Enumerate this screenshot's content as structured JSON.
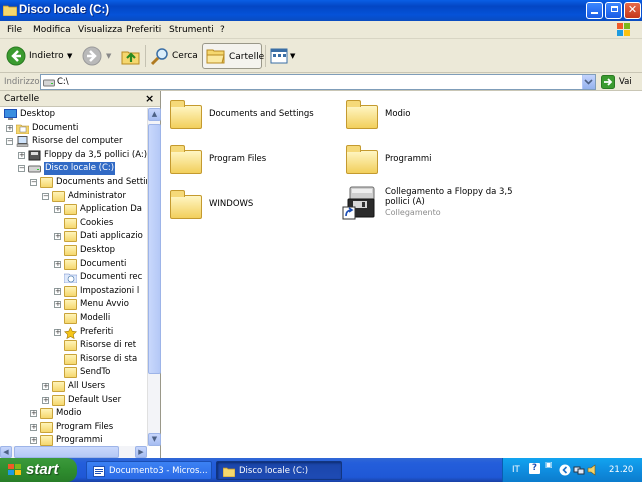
{
  "window": {
    "title": "Disco locale (C:)"
  },
  "menu": [
    "File",
    "Modifica",
    "Visualizza",
    "Preferiti",
    "Strumenti",
    "?"
  ],
  "toolbar": {
    "back": "Indietro",
    "search": "Cerca",
    "folders": "Cartelle"
  },
  "address": {
    "label": "Indirizzo",
    "value": "C:\\",
    "go": "Vai"
  },
  "folders_pane": {
    "title": "Cartelle",
    "close": "×",
    "tree": [
      {
        "label": "Desktop",
        "level": 0,
        "expander": "",
        "icon": "desktop-icon"
      },
      {
        "label": "Documenti",
        "level": 1,
        "expander": "+",
        "icon": "documents-icon"
      },
      {
        "label": "Risorse del computer",
        "level": 1,
        "expander": "-",
        "icon": "my-computer-icon"
      },
      {
        "label": "Floppy da 3,5 pollici (A:)",
        "level": 2,
        "expander": "+",
        "icon": "floppy-icon"
      },
      {
        "label": "Disco locale (C:)",
        "level": 2,
        "expander": "-",
        "icon": "drive-icon",
        "selected": true
      },
      {
        "label": "Documents and Settin",
        "level": 3,
        "expander": "-",
        "icon": "folder-icon"
      },
      {
        "label": "Administrator",
        "level": 4,
        "expander": "-",
        "icon": "folder-icon"
      },
      {
        "label": "Application Da",
        "level": 5,
        "expander": "+",
        "icon": "folder-icon"
      },
      {
        "label": "Cookies",
        "level": 5,
        "expander": "",
        "icon": "folder-icon"
      },
      {
        "label": "Dati applicazio",
        "level": 5,
        "expander": "+",
        "icon": "folder-icon"
      },
      {
        "label": "Desktop",
        "level": 5,
        "expander": "",
        "icon": "folder-icon"
      },
      {
        "label": "Documenti",
        "level": 5,
        "expander": "+",
        "icon": "folder-icon"
      },
      {
        "label": "Documenti rec",
        "level": 5,
        "expander": "",
        "icon": "recent-docs-icon"
      },
      {
        "label": "Impostazioni l",
        "level": 5,
        "expander": "+",
        "icon": "folder-icon"
      },
      {
        "label": "Menu Avvio",
        "level": 5,
        "expander": "+",
        "icon": "folder-icon"
      },
      {
        "label": "Modelli",
        "level": 5,
        "expander": "",
        "icon": "folder-icon"
      },
      {
        "label": "Preferiti",
        "level": 5,
        "expander": "+",
        "icon": "favorites-star-icon"
      },
      {
        "label": "Risorse di ret",
        "level": 5,
        "expander": "",
        "icon": "folder-icon"
      },
      {
        "label": "Risorse di sta",
        "level": 5,
        "expander": "",
        "icon": "folder-icon"
      },
      {
        "label": "SendTo",
        "level": 5,
        "expander": "",
        "icon": "folder-icon"
      },
      {
        "label": "All Users",
        "level": 4,
        "expander": "+",
        "icon": "folder-icon"
      },
      {
        "label": "Default User",
        "level": 4,
        "expander": "+",
        "icon": "folder-icon"
      },
      {
        "label": "Modio",
        "level": 3,
        "expander": "+",
        "icon": "folder-icon"
      },
      {
        "label": "Program Files",
        "level": 3,
        "expander": "+",
        "icon": "folder-icon"
      },
      {
        "label": "Programmi",
        "level": 3,
        "expander": "+",
        "icon": "folder-icon"
      }
    ]
  },
  "content": {
    "items": [
      {
        "name": "Documents and Settings",
        "type": "folder"
      },
      {
        "name": "Modio",
        "type": "folder"
      },
      {
        "name": "Program Files",
        "type": "folder"
      },
      {
        "name": "Programmi",
        "type": "folder"
      },
      {
        "name": "WINDOWS",
        "type": "folder"
      },
      {
        "name": "Collegamento a Floppy da 3,5 pollici (A)",
        "type": "shortcut",
        "subtitle": "Collegamento"
      }
    ]
  },
  "taskbar": {
    "start": "start",
    "tasks": [
      {
        "label": "Documento3 - Micros...",
        "icon": "word-icon",
        "active": false
      },
      {
        "label": "Disco locale (C:)",
        "icon": "folder-icon",
        "active": true
      }
    ],
    "tray": {
      "lang": "IT",
      "help": "?",
      "time": "21.20"
    }
  }
}
